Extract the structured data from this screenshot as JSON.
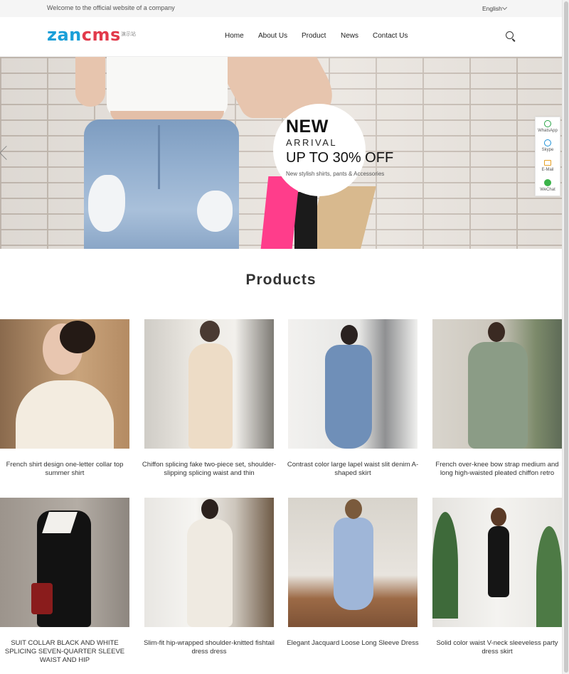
{
  "topbar": {
    "welcome": "Welcome to the official website of a company",
    "language": "English"
  },
  "header": {
    "logo_part1": "zan",
    "logo_part2": "cms",
    "logo_sub": "演示站",
    "nav": [
      "Home",
      "About Us",
      "Product",
      "News",
      "Contact Us"
    ]
  },
  "banner": {
    "headline": "NEW",
    "subheadline": "ARRIVAL",
    "offer": "UP TO 30% OFF",
    "tagline": "New stylish shirts, pants & Accessories"
  },
  "contact_float": [
    {
      "label": "WhatsApp",
      "icon": "whatsapp-icon",
      "color": "#25a244"
    },
    {
      "label": "Skype",
      "icon": "skype-icon",
      "color": "#1a8fd6"
    },
    {
      "label": "E-Mail",
      "icon": "email-icon",
      "color": "#e6a127"
    },
    {
      "label": "WeChat",
      "icon": "wechat-icon",
      "color": "#3bb34a"
    }
  ],
  "products": {
    "title": "Products",
    "items": [
      {
        "name": "French shirt design one-letter collar top summer shirt"
      },
      {
        "name": "Chiffon splicing fake two-piece set, shoulder-slipping splicing waist and thin"
      },
      {
        "name": "Contrast color large lapel waist slit denim A-shaped skirt"
      },
      {
        "name": "French over-knee bow strap medium and long high-waisted pleated chiffon retro"
      },
      {
        "name": "SUIT COLLAR BLACK AND WHITE SPLICING SEVEN-QUARTER SLEEVE WAIST AND HIP"
      },
      {
        "name": "Slim-fit hip-wrapped shoulder-knitted fishtail dress dress"
      },
      {
        "name": "Elegant Jacquard Loose Long Sleeve Dress"
      },
      {
        "name": "Solid color waist V-neck sleeveless party dress skirt"
      }
    ]
  },
  "colors": {
    "logo_blue": "#1a9fd8",
    "logo_red": "#e23a4b",
    "topbar_bg": "#f5f5f5"
  }
}
